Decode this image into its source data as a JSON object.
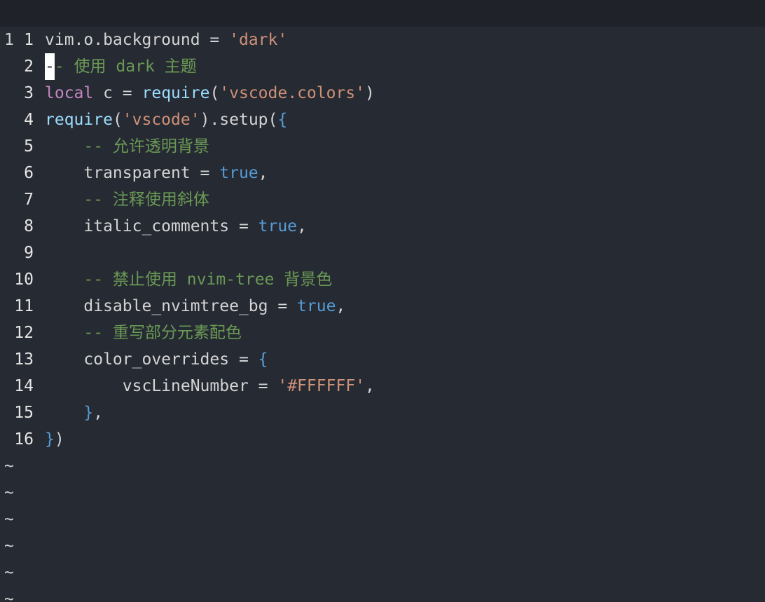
{
  "theme": {
    "background": "#262a33",
    "current_line_bg": "#1f2229",
    "comment": "#6a9955",
    "keyword": "#c586c0",
    "function": "#9cdcfe",
    "string": "#ce9178",
    "boolean": "#569cd6",
    "text": "#d4d4d4"
  },
  "current_line": {
    "number": "1",
    "cursor_char": "-",
    "rest": "- 使用 dark 主题"
  },
  "lines": [
    {
      "number": "1",
      "tokens": [
        {
          "t": "txt",
          "v": "vim.o.background = "
        },
        {
          "t": "str",
          "v": "'dark'"
        }
      ]
    },
    {
      "number": "2",
      "tokens": []
    },
    {
      "number": "3",
      "tokens": [
        {
          "t": "kw",
          "v": "local"
        },
        {
          "t": "txt",
          "v": " c = "
        },
        {
          "t": "fn",
          "v": "require"
        },
        {
          "t": "txt",
          "v": "("
        },
        {
          "t": "str",
          "v": "'vscode.colors'"
        },
        {
          "t": "txt",
          "v": ")"
        }
      ]
    },
    {
      "number": "4",
      "tokens": [
        {
          "t": "fn",
          "v": "require"
        },
        {
          "t": "txt",
          "v": "("
        },
        {
          "t": "str",
          "v": "'vscode'"
        },
        {
          "t": "txt",
          "v": ").setup("
        },
        {
          "t": "brace",
          "v": "{"
        }
      ]
    },
    {
      "number": "5",
      "tokens": [
        {
          "t": "txt",
          "v": "    "
        },
        {
          "t": "cmt",
          "v": "-- 允许透明背景"
        }
      ]
    },
    {
      "number": "6",
      "tokens": [
        {
          "t": "txt",
          "v": "    transparent = "
        },
        {
          "t": "bool",
          "v": "true"
        },
        {
          "t": "txt",
          "v": ","
        }
      ]
    },
    {
      "number": "7",
      "tokens": [
        {
          "t": "txt",
          "v": "    "
        },
        {
          "t": "cmt",
          "v": "-- 注释使用斜体"
        }
      ]
    },
    {
      "number": "8",
      "tokens": [
        {
          "t": "txt",
          "v": "    italic_comments = "
        },
        {
          "t": "bool",
          "v": "true"
        },
        {
          "t": "txt",
          "v": ","
        }
      ]
    },
    {
      "number": "9",
      "tokens": []
    },
    {
      "number": "10",
      "tokens": [
        {
          "t": "txt",
          "v": "    "
        },
        {
          "t": "cmt",
          "v": "-- 禁止使用 nvim-tree 背景色"
        }
      ]
    },
    {
      "number": "11",
      "tokens": [
        {
          "t": "txt",
          "v": "    disable_nvimtree_bg = "
        },
        {
          "t": "bool",
          "v": "true"
        },
        {
          "t": "txt",
          "v": ","
        }
      ]
    },
    {
      "number": "12",
      "tokens": [
        {
          "t": "txt",
          "v": "    "
        },
        {
          "t": "cmt",
          "v": "-- 重写部分元素配色"
        }
      ]
    },
    {
      "number": "13",
      "tokens": [
        {
          "t": "txt",
          "v": "    color_overrides = "
        },
        {
          "t": "brace",
          "v": "{"
        }
      ]
    },
    {
      "number": "14",
      "tokens": [
        {
          "t": "txt",
          "v": "        vscLineNumber = "
        },
        {
          "t": "str",
          "v": "'#FFFFFF'"
        },
        {
          "t": "txt",
          "v": ","
        }
      ]
    },
    {
      "number": "15",
      "tokens": [
        {
          "t": "txt",
          "v": "    "
        },
        {
          "t": "brace",
          "v": "}"
        },
        {
          "t": "txt",
          "v": ","
        }
      ]
    },
    {
      "number": "16",
      "tokens": [
        {
          "t": "brace",
          "v": "}"
        },
        {
          "t": "txt",
          "v": ")"
        }
      ]
    }
  ],
  "empty_line_marker": "~",
  "empty_lines": 6
}
